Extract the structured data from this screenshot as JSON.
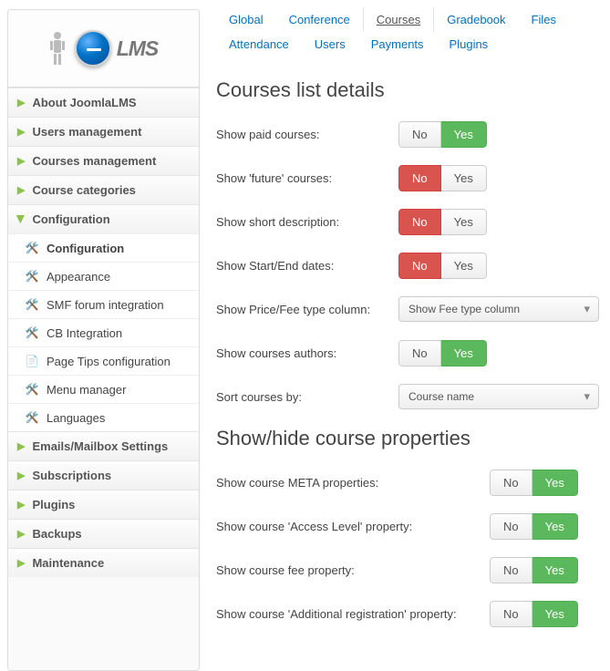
{
  "logo_text": "LMS",
  "tabs": {
    "global": "Global",
    "conference": "Conference",
    "courses": "Courses",
    "gradebook": "Gradebook",
    "files": "Files",
    "attendance": "Attendance",
    "users": "Users",
    "payments": "Payments",
    "plugins": "Plugins"
  },
  "sidebar": {
    "about": "About JoomlaLMS",
    "users_mgmt": "Users management",
    "courses_mgmt": "Courses management",
    "course_cats": "Course categories",
    "config": "Configuration",
    "config_sub": {
      "configuration": "Configuration",
      "appearance": "Appearance",
      "smf": "SMF forum integration",
      "cb": "CB Integration",
      "page_tips": "Page Tips configuration",
      "menu": "Menu manager",
      "languages": "Languages"
    },
    "emails": "Emails/Mailbox Settings",
    "subscriptions": "Subscriptions",
    "plugins": "Plugins",
    "backups": "Backups",
    "maintenance": "Maintenance"
  },
  "section1": {
    "title": "Courses list details",
    "rows": {
      "paid": {
        "label": "Show paid courses:",
        "value": "Yes"
      },
      "future": {
        "label": "Show 'future' courses:",
        "value": "No"
      },
      "short": {
        "label": "Show short description:",
        "value": "No"
      },
      "dates": {
        "label": "Show Start/End dates:",
        "value": "No"
      },
      "fee_col": {
        "label": "Show Price/Fee type column:",
        "value": "Show Fee type column"
      },
      "authors": {
        "label": "Show courses authors:",
        "value": "Yes"
      },
      "sort": {
        "label": "Sort courses by:",
        "value": "Course name"
      }
    }
  },
  "section2": {
    "title": "Show/hide course properties",
    "rows": {
      "meta": {
        "label": "Show course META properties:",
        "value": "Yes"
      },
      "access": {
        "label": "Show course 'Access Level' property:",
        "value": "Yes"
      },
      "fee": {
        "label": "Show course fee property:",
        "value": "Yes"
      },
      "addreg": {
        "label": "Show course 'Additional registration' property:",
        "value": "Yes"
      }
    }
  },
  "toggle_labels": {
    "no": "No",
    "yes": "Yes"
  }
}
